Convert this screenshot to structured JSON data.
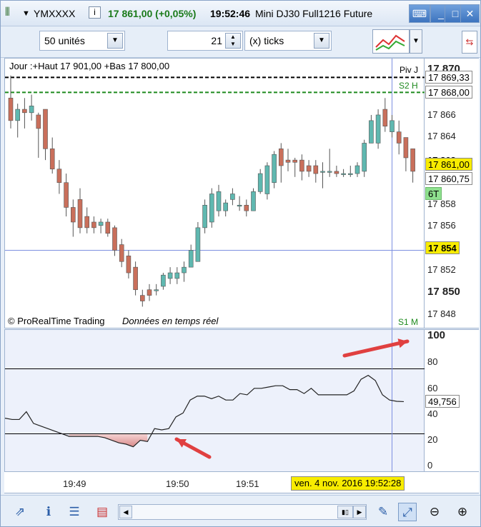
{
  "titlebar": {
    "symbol": "YMXXXX",
    "last_price": "17 861,00 (+0,05%)",
    "time": "19:52:46",
    "instrument": "Mini DJ30 Full1216 Future",
    "colors": {
      "price_text": "#1a7a1a"
    }
  },
  "toolbar": {
    "units_select": "50 unités",
    "ticks_value": "21",
    "ticks_type": "(x) ticks"
  },
  "price_pane": {
    "header": "Jour :+Haut 17 901,00 +Bas 17 800,00",
    "copyright": "© ProRealTime Trading",
    "realtime": "Données en temps réel",
    "pivot_label": "Piv J",
    "s2_label": "S2 H",
    "s1_label": "S1 M",
    "axis_labels": [
      "17 870",
      "17 866",
      "17 864",
      "17 858",
      "17 856",
      "17 852",
      "17 850",
      "17 848"
    ],
    "tags": {
      "pivot": "17 869,33",
      "s2": "17 868,00",
      "hidden": "17 862",
      "last": "17 861,00",
      "bid": "17 860,75",
      "ticks_left": "6T",
      "crosshair": "17 854"
    }
  },
  "indicator_pane": {
    "axis_labels": [
      "100",
      "80",
      "60",
      "40",
      "20",
      "0"
    ],
    "value_tag": "49,756"
  },
  "time_axis": {
    "labels": [
      "19:49",
      "19:50",
      "19:51"
    ],
    "cursor_time": "ven. 4 nov. 2016 19:52:28"
  },
  "colors": {
    "bull": "#5fb8b0",
    "bear": "#c96f5b",
    "pivot_line": "#000000",
    "s2_line": "#1e8a1e",
    "crosshair": "#7d8fe0",
    "tag_yellow": "#f8ec00",
    "tag_green": "#8ee08e",
    "arrow": "#e04040"
  },
  "chart_data": {
    "type": "candlestick",
    "title": "Mini DJ30 Full1216 Future",
    "ylim": [
      17847,
      17871
    ],
    "candles": [
      {
        "o": 17867.5,
        "h": 17869.5,
        "l": 17864.8,
        "c": 17865.5
      },
      {
        "o": 17865.5,
        "h": 17867.0,
        "l": 17864.0,
        "c": 17866.5
      },
      {
        "o": 17866.5,
        "h": 17867.5,
        "l": 17864.8,
        "c": 17866.2
      },
      {
        "o": 17866.2,
        "h": 17867.8,
        "l": 17865.5,
        "c": 17866.8
      },
      {
        "o": 17866.0,
        "h": 17866.2,
        "l": 17862.2,
        "c": 17864.8
      },
      {
        "o": 17866.5,
        "h": 17866.5,
        "l": 17862.0,
        "c": 17863.0
      },
      {
        "o": 17863.0,
        "h": 17864.0,
        "l": 17860.8,
        "c": 17861.2
      },
      {
        "o": 17861.2,
        "h": 17862.0,
        "l": 17859.0,
        "c": 17860.0
      },
      {
        "o": 17860.0,
        "h": 17860.8,
        "l": 17857.0,
        "c": 17857.8
      },
      {
        "o": 17857.8,
        "h": 17858.5,
        "l": 17855.2,
        "c": 17856.5
      },
      {
        "o": 17858.5,
        "h": 17859.5,
        "l": 17855.5,
        "c": 17856.0
      },
      {
        "o": 17857.0,
        "h": 17857.8,
        "l": 17855.5,
        "c": 17856.0
      },
      {
        "o": 17856.5,
        "h": 17857.0,
        "l": 17855.5,
        "c": 17856.0
      },
      {
        "o": 17856.2,
        "h": 17856.8,
        "l": 17855.5,
        "c": 17856.5
      },
      {
        "o": 17856.5,
        "h": 17856.8,
        "l": 17855.2,
        "c": 17855.5
      },
      {
        "o": 17856.0,
        "h": 17856.2,
        "l": 17853.5,
        "c": 17854.0
      },
      {
        "o": 17854.5,
        "h": 17855.0,
        "l": 17852.5,
        "c": 17853.0
      },
      {
        "o": 17853.5,
        "h": 17854.0,
        "l": 17851.5,
        "c": 17852.0
      },
      {
        "o": 17852.5,
        "h": 17853.0,
        "l": 17850.0,
        "c": 17850.5
      },
      {
        "o": 17850.0,
        "h": 17850.5,
        "l": 17849.0,
        "c": 17849.5
      },
      {
        "o": 17850.5,
        "h": 17851.0,
        "l": 17849.5,
        "c": 17850.0
      },
      {
        "o": 17850.5,
        "h": 17851.0,
        "l": 17850.0,
        "c": 17850.5
      },
      {
        "o": 17850.8,
        "h": 17852.0,
        "l": 17850.5,
        "c": 17851.8
      },
      {
        "o": 17851.5,
        "h": 17852.5,
        "l": 17851.0,
        "c": 17852.0
      },
      {
        "o": 17851.5,
        "h": 17852.5,
        "l": 17851.0,
        "c": 17852.0
      },
      {
        "o": 17852.0,
        "h": 17853.0,
        "l": 17851.2,
        "c": 17852.5
      },
      {
        "o": 17852.5,
        "h": 17854.5,
        "l": 17852.5,
        "c": 17854.0
      },
      {
        "o": 17853.0,
        "h": 17856.5,
        "l": 17853.0,
        "c": 17856.0
      },
      {
        "o": 17856.0,
        "h": 17858.5,
        "l": 17855.5,
        "c": 17858.0
      },
      {
        "o": 17856.5,
        "h": 17859.5,
        "l": 17856.0,
        "c": 17859.0
      },
      {
        "o": 17857.5,
        "h": 17859.8,
        "l": 17857.0,
        "c": 17859.2
      },
      {
        "o": 17857.5,
        "h": 17858.5,
        "l": 17857.0,
        "c": 17858.2
      },
      {
        "o": 17858.5,
        "h": 17859.5,
        "l": 17858.0,
        "c": 17859.0
      },
      {
        "o": 17858.0,
        "h": 17858.8,
        "l": 17857.5,
        "c": 17858.0
      },
      {
        "o": 17858.0,
        "h": 17858.5,
        "l": 17857.0,
        "c": 17857.5
      },
      {
        "o": 17857.5,
        "h": 17859.5,
        "l": 17857.5,
        "c": 17859.2
      },
      {
        "o": 17859.2,
        "h": 17861.2,
        "l": 17859.0,
        "c": 17860.8
      },
      {
        "o": 17859.0,
        "h": 17861.8,
        "l": 17858.5,
        "c": 17861.5
      },
      {
        "o": 17860.0,
        "h": 17862.8,
        "l": 17859.5,
        "c": 17862.5
      },
      {
        "o": 17863.0,
        "h": 17863.5,
        "l": 17860.0,
        "c": 17861.5
      },
      {
        "o": 17862.0,
        "h": 17863.0,
        "l": 17861.0,
        "c": 17861.8
      },
      {
        "o": 17862.0,
        "h": 17862.2,
        "l": 17860.5,
        "c": 17861.8
      },
      {
        "o": 17862.0,
        "h": 17862.5,
        "l": 17860.2,
        "c": 17861.0
      },
      {
        "o": 17861.5,
        "h": 17862.0,
        "l": 17860.5,
        "c": 17861.0
      },
      {
        "o": 17861.5,
        "h": 17862.0,
        "l": 17860.0,
        "c": 17860.8
      },
      {
        "o": 17861.0,
        "h": 17861.8,
        "l": 17859.5,
        "c": 17861.0
      },
      {
        "o": 17861.0,
        "h": 17863.0,
        "l": 17860.5,
        "c": 17861.0
      },
      {
        "o": 17861.0,
        "h": 17861.5,
        "l": 17860.5,
        "c": 17860.8
      },
      {
        "o": 17860.8,
        "h": 17861.2,
        "l": 17860.5,
        "c": 17860.8
      },
      {
        "o": 17860.8,
        "h": 17861.5,
        "l": 17860.5,
        "c": 17860.8
      },
      {
        "o": 17860.8,
        "h": 17861.8,
        "l": 17860.5,
        "c": 17861.5
      },
      {
        "o": 17861.0,
        "h": 17863.8,
        "l": 17860.5,
        "c": 17863.5
      },
      {
        "o": 17863.5,
        "h": 17866.0,
        "l": 17863.5,
        "c": 17865.5
      },
      {
        "o": 17863.5,
        "h": 17866.5,
        "l": 17863.0,
        "c": 17866.0
      },
      {
        "o": 17866.5,
        "h": 17867.5,
        "l": 17864.5,
        "c": 17865.0
      },
      {
        "o": 17864.5,
        "h": 17866.0,
        "l": 17864.0,
        "c": 17865.5
      },
      {
        "o": 17864.5,
        "h": 17865.5,
        "l": 17862.5,
        "c": 17863.5
      },
      {
        "o": 17864.0,
        "h": 17864.0,
        "l": 17861.0,
        "c": 17862.2
      },
      {
        "o": 17863.0,
        "h": 17863.0,
        "l": 17860.0,
        "c": 17861.0
      }
    ],
    "indicator": {
      "name": "oscillator",
      "ylim": [
        -5,
        105
      ],
      "levels": [
        75,
        25
      ],
      "values": [
        37,
        36,
        36,
        42,
        33,
        31,
        29,
        27,
        25,
        23,
        23,
        23,
        23,
        23,
        22,
        20,
        18,
        17,
        15,
        20,
        19,
        29,
        28,
        29,
        38,
        41,
        51,
        54,
        54,
        52,
        54,
        51,
        51,
        56,
        55,
        60,
        60,
        61,
        62,
        62,
        59,
        59,
        56,
        60,
        55,
        55,
        55,
        55,
        55,
        58,
        67,
        70,
        66,
        55,
        51,
        50,
        49.756
      ]
    }
  }
}
